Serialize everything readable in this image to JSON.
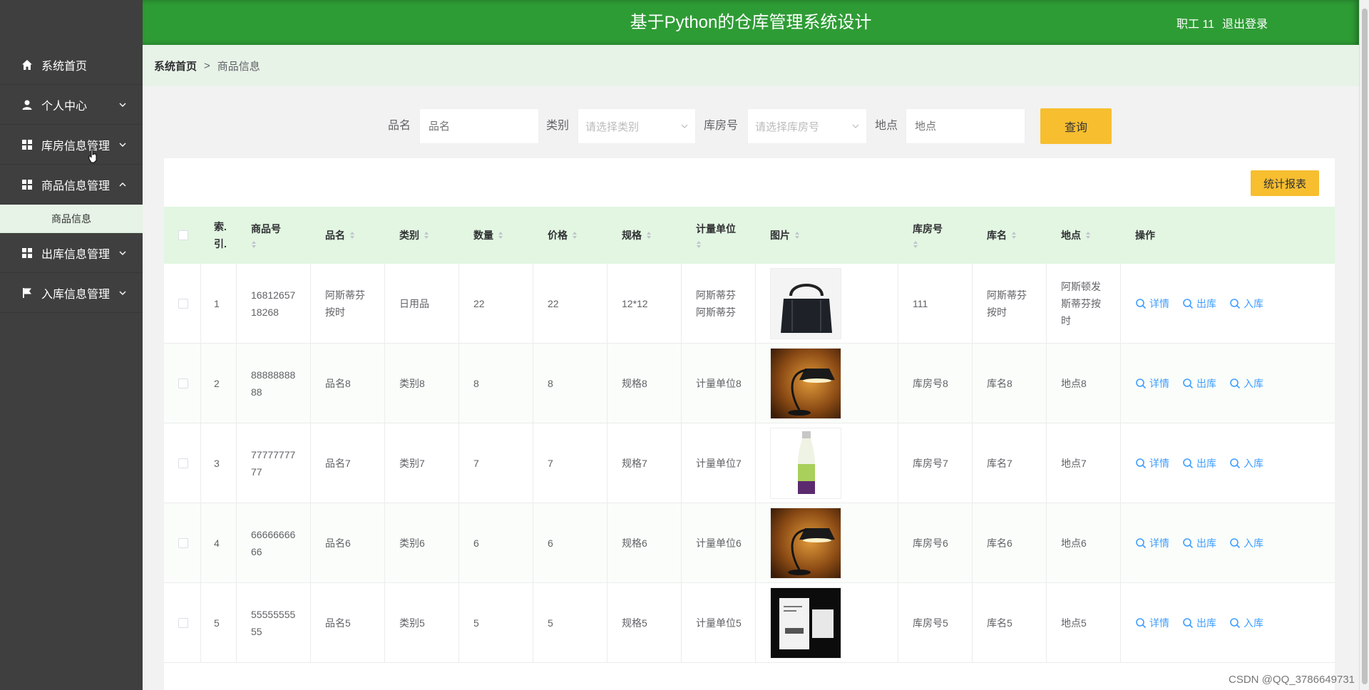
{
  "header": {
    "title": "基于Python的仓库管理系统设计",
    "user": "职工 11",
    "logout": "退出登录"
  },
  "sidebar": {
    "items": [
      {
        "label": "系统首页",
        "icon": "home-icon"
      },
      {
        "label": "个人中心",
        "icon": "user-icon"
      },
      {
        "label": "库房信息管理",
        "icon": "grid-icon"
      },
      {
        "label": "商品信息管理",
        "icon": "grid-icon"
      },
      {
        "label": "出库信息管理",
        "icon": "grid-icon"
      },
      {
        "label": "入库信息管理",
        "icon": "flag-icon"
      }
    ],
    "submenu": {
      "label": "商品信息"
    }
  },
  "breadcrumb": {
    "home": "系统首页",
    "sep": ">",
    "current": "商品信息"
  },
  "search": {
    "name_label": "品名",
    "name_placeholder": "品名",
    "category_label": "类别",
    "category_placeholder": "请选择类别",
    "room_label": "库房号",
    "room_placeholder": "请选择库房号",
    "place_label": "地点",
    "place_placeholder": "地点",
    "query_button": "查询"
  },
  "report_button": "统计报表",
  "table": {
    "columns": [
      "索引",
      "商品号",
      "品名",
      "类别",
      "数量",
      "价格",
      "规格",
      "计量单位",
      "图片",
      "库房号",
      "库名",
      "地点",
      "操作"
    ],
    "index_header": "索.引.",
    "actions": {
      "detail": "详情",
      "out": "出库",
      "in": "入库"
    },
    "rows": [
      {
        "index": "1",
        "code": "1681265718268",
        "name": "阿斯蒂芬按时",
        "category": "日用品",
        "qty": "22",
        "price": "22",
        "spec": "12*12",
        "unit": "阿斯蒂芬阿斯蒂芬",
        "image": "bag",
        "room": "111",
        "store": "阿斯蒂芬按时",
        "place": "阿斯顿发斯蒂芬按时"
      },
      {
        "index": "2",
        "code": "8888888888",
        "name": "品名8",
        "category": "类别8",
        "qty": "8",
        "price": "8",
        "spec": "规格8",
        "unit": "计量单位8",
        "image": "lamp",
        "room": "库房号8",
        "store": "库名8",
        "place": "地点8"
      },
      {
        "index": "3",
        "code": "7777777777",
        "name": "品名7",
        "category": "类别7",
        "qty": "7",
        "price": "7",
        "spec": "规格7",
        "unit": "计量单位7",
        "image": "bottle",
        "room": "库房号7",
        "store": "库名7",
        "place": "地点7"
      },
      {
        "index": "4",
        "code": "6666666666",
        "name": "品名6",
        "category": "类别6",
        "qty": "6",
        "price": "6",
        "spec": "规格6",
        "unit": "计量单位6",
        "image": "lamp",
        "room": "库房号6",
        "store": "库名6",
        "place": "地点6"
      },
      {
        "index": "5",
        "code": "5555555555",
        "name": "品名5",
        "category": "类别5",
        "qty": "5",
        "price": "5",
        "spec": "规格5",
        "unit": "计量单位5",
        "image": "book",
        "room": "库房号5",
        "store": "库名5",
        "place": "地点5"
      }
    ]
  },
  "watermark": "CSDN @QQ_3786649731",
  "colors": {
    "header": "#2e9c35",
    "sidebar": "#3f3f3f",
    "accent_button": "#f7be2f",
    "table_head": "#e2f6e2",
    "link": "#409eff"
  }
}
